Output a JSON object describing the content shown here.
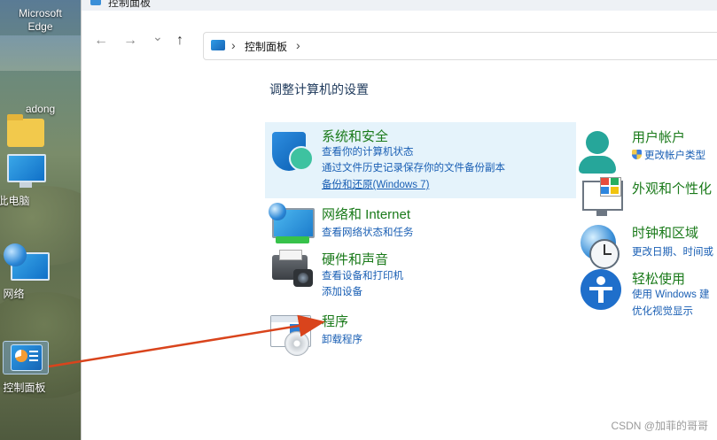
{
  "desktop": {
    "icons": [
      {
        "label": "Microsoft\nEdge"
      },
      {
        "label": "adong"
      },
      {
        "label": "此电脑"
      },
      {
        "label": "网络"
      },
      {
        "label": "控制面板"
      }
    ],
    "edge_label_1": "Microsoft",
    "edge_label_2": "Edge"
  },
  "window": {
    "title": "控制面板",
    "nav": {
      "back_icon": "←",
      "forward_icon": "→",
      "recent_icon": "⌄",
      "up_icon": "↑"
    },
    "address": {
      "sep": "›",
      "crumb": "控制面板",
      "sep_end": "›"
    }
  },
  "content": {
    "heading": "调整计算机的设置",
    "categories": {
      "system": {
        "title": "系统和安全",
        "links": [
          "查看你的计算机状态",
          "通过文件历史记录保存你的文件备份副本",
          "备份和还原(Windows 7)"
        ]
      },
      "network": {
        "title": "网络和 Internet",
        "links": [
          "查看网络状态和任务"
        ]
      },
      "hardware": {
        "title": "硬件和声音",
        "links": [
          "查看设备和打印机",
          "添加设备"
        ]
      },
      "programs": {
        "title": "程序",
        "links": [
          "卸载程序"
        ]
      },
      "user": {
        "title": "用户帐户",
        "links": [
          "更改帐户类型"
        ]
      },
      "appearance": {
        "title": "外观和个性化",
        "links": []
      },
      "clock": {
        "title": "时钟和区域",
        "links": [
          "更改日期、时间或"
        ]
      },
      "ease": {
        "title": "轻松使用",
        "links": [
          "使用 Windows 建",
          "优化视觉显示"
        ]
      }
    }
  },
  "accent_colors": {
    "category_title": "#1a7a1a",
    "link": "#1a5fb4",
    "selection": "#e5f3fb",
    "arrow": "#d9441c"
  },
  "watermark": "CSDN @加菲的哥哥"
}
